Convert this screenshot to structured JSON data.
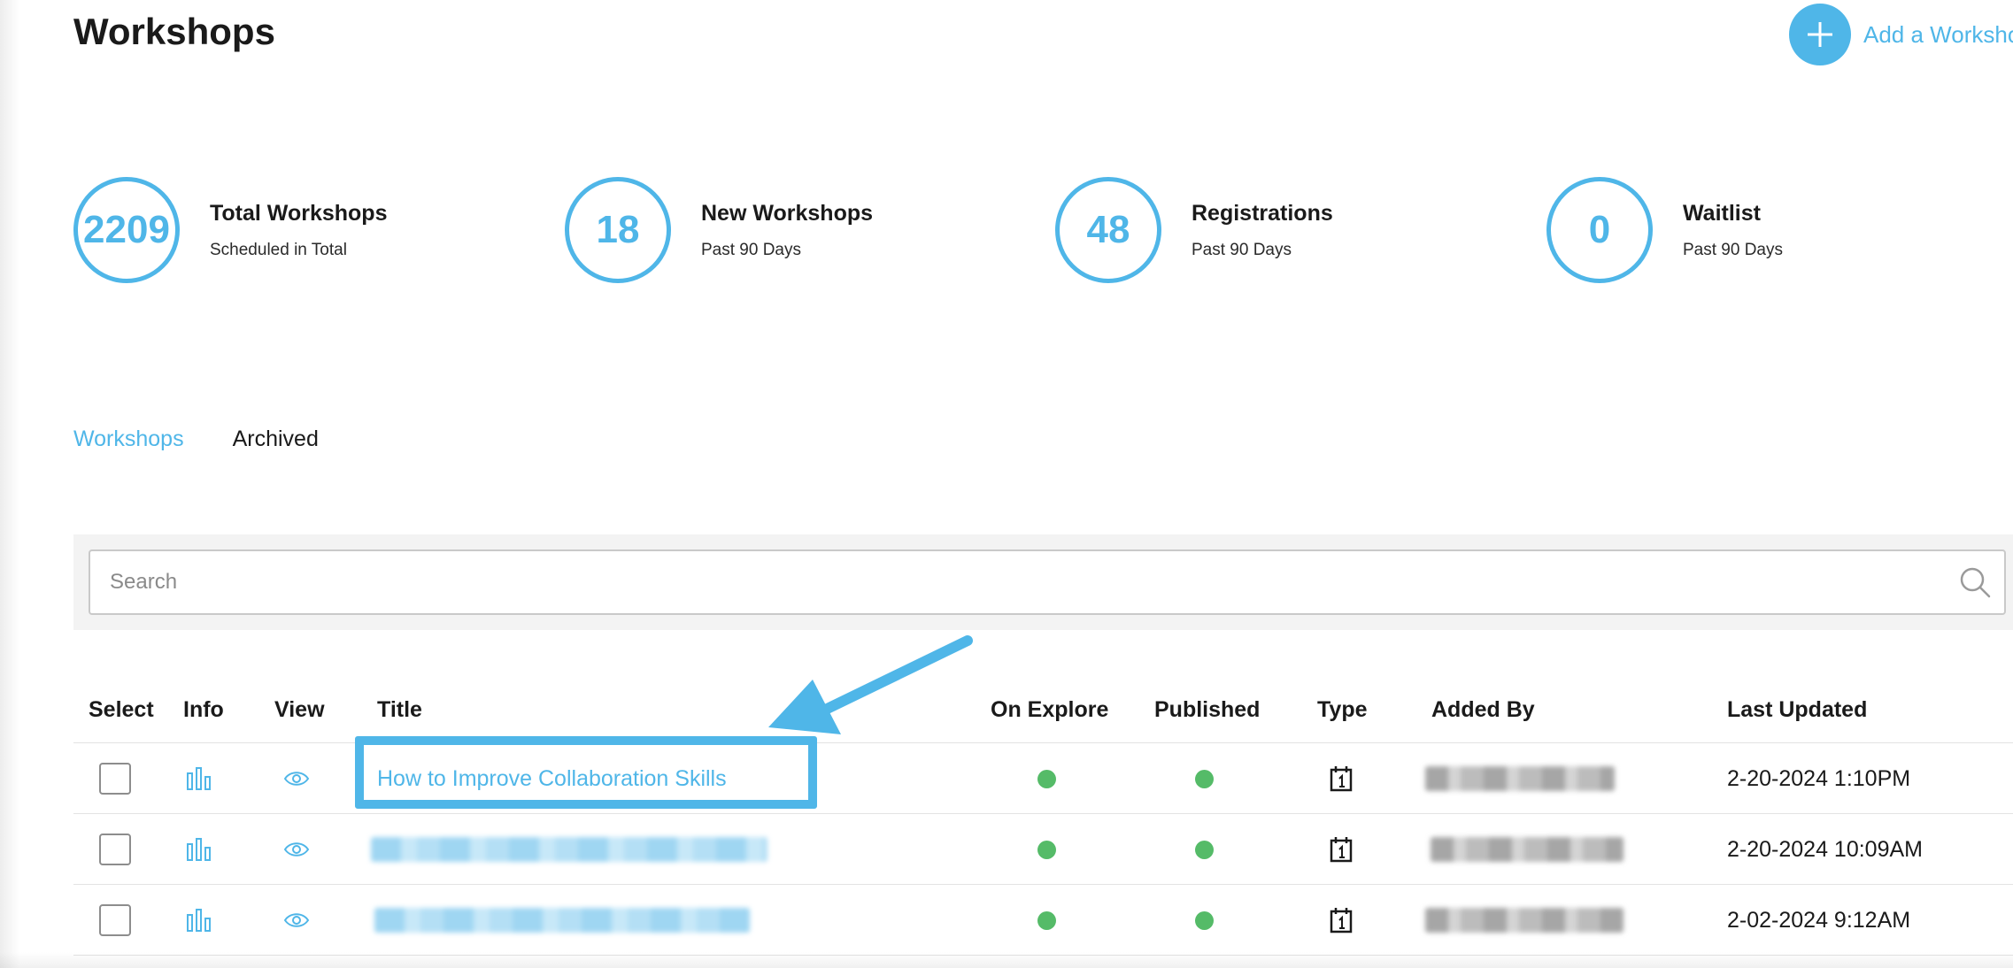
{
  "page": {
    "title": "Workshops",
    "add_button_label": "Add a Worksho"
  },
  "stats": [
    {
      "value": "2209",
      "title": "Total Workshops",
      "subtitle": "Scheduled in Total"
    },
    {
      "value": "18",
      "title": "New Workshops",
      "subtitle": "Past 90 Days"
    },
    {
      "value": "48",
      "title": "Registrations",
      "subtitle": "Past 90 Days"
    },
    {
      "value": "0",
      "title": "Waitlist",
      "subtitle": "Past 90 Days"
    }
  ],
  "tabs": [
    {
      "label": "Workshops",
      "active": true
    },
    {
      "label": "Archived",
      "active": false
    }
  ],
  "search": {
    "placeholder": "Search",
    "value": ""
  },
  "table": {
    "columns": [
      "Select",
      "Info",
      "View",
      "Title",
      "On Explore",
      "Published",
      "Type",
      "Added By",
      "Last Updated"
    ],
    "rows": [
      {
        "title": "How to Improve Collaboration Skills",
        "title_visible": true,
        "on_explore": true,
        "published": true,
        "type": "calendar-icon",
        "added_by": "",
        "last_updated": "2-20-2024 1:10PM",
        "highlighted": true
      },
      {
        "title": "",
        "title_visible": false,
        "on_explore": true,
        "published": true,
        "type": "calendar-icon",
        "added_by": "",
        "last_updated": "2-20-2024 10:09AM",
        "highlighted": false
      },
      {
        "title": "",
        "title_visible": false,
        "on_explore": true,
        "published": true,
        "type": "calendar-icon",
        "added_by": "",
        "last_updated": "2-02-2024 9:12AM",
        "highlighted": false
      }
    ]
  },
  "colors": {
    "accent": "#4fb6e8",
    "status_green": "#55bb68",
    "text": "#1a1a1a"
  },
  "icons": {
    "info": "bar-chart-icon",
    "view": "eye-icon",
    "type": "calendar-icon",
    "search": "search-icon",
    "add": "plus-icon"
  }
}
